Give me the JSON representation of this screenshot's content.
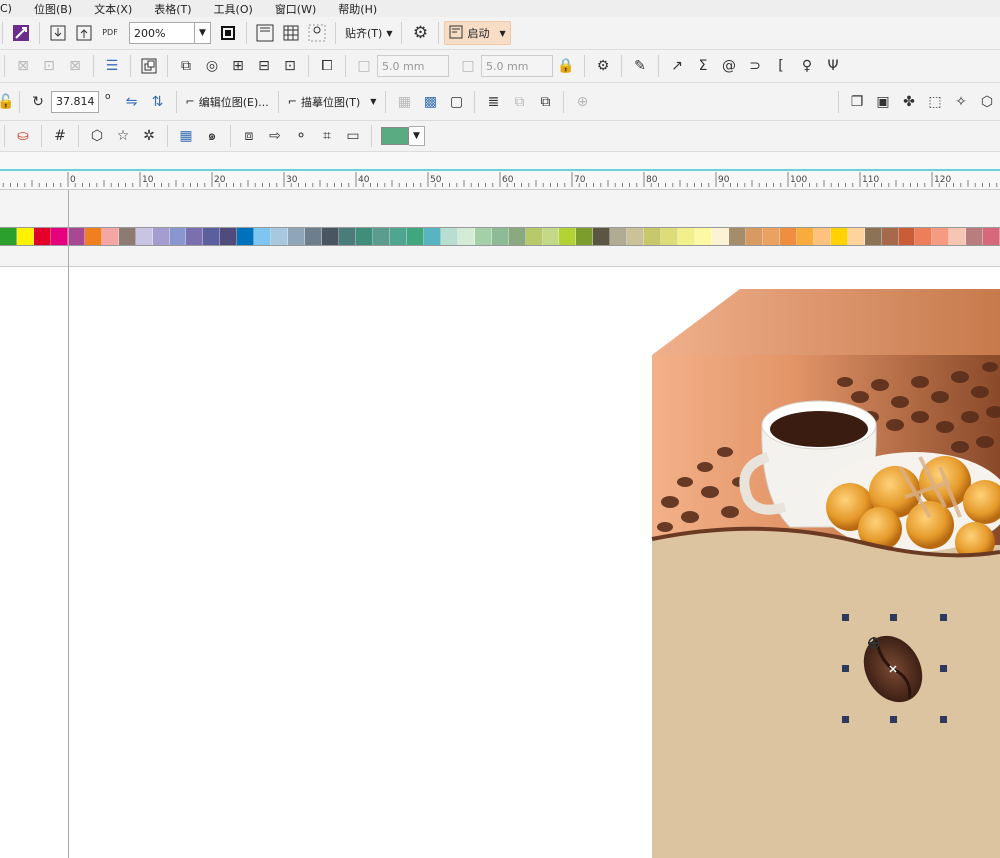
{
  "menu": [
    "C)",
    "位图(B)",
    "文本(X)",
    "表格(T)",
    "工具(O)",
    "窗口(W)",
    "帮助(H)"
  ],
  "toolbar1": {
    "pdf_label": "PDF",
    "zoom": "200%",
    "snap_label": "贴齐(T)",
    "launch_label": "启动"
  },
  "toolbar2": {
    "offset1": "5.0 mm",
    "offset2": "5.0 mm"
  },
  "toolbar3": {
    "angle": "37.814",
    "degree_symbol": "o",
    "edit_bitmap": "编辑位图(E)...",
    "trace_bitmap": "描摹位图(T)"
  },
  "toolbar4": {
    "fill_color": "#5aab82"
  },
  "ruler": {
    "ticks": [
      "0",
      "10",
      "20",
      "30",
      "40",
      "50",
      "60",
      "70",
      "80",
      "90",
      "100",
      "110",
      "120"
    ]
  },
  "palette": [
    "#2ca02c",
    "#fff200",
    "#e4002b",
    "#e6007e",
    "#a84893",
    "#f07f22",
    "#f4a6a4",
    "#8c7b70",
    "#c9c3e4",
    "#a49dd0",
    "#8a96cf",
    "#7b6faf",
    "#5a5f9e",
    "#4f4b7a",
    "#0072bc",
    "#7ec5ef",
    "#a8c8e0",
    "#8fa6b8",
    "#6d7f8c",
    "#49565f",
    "#4a7d7a",
    "#3e8e79",
    "#5a9c8d",
    "#50a58e",
    "#41a67d",
    "#58b4c0",
    "#b8ddd1",
    "#d4ebd6",
    "#a5cfa9",
    "#8dbb95",
    "#8aa97e",
    "#b7c96a",
    "#c4d987",
    "#b3d234",
    "#7c9d2c",
    "#5b5642",
    "#b2ab94",
    "#cbc29a",
    "#c7c76c",
    "#dcdc7a",
    "#f2ef8d",
    "#fcf8a3",
    "#fcf3d4",
    "#a58d6b",
    "#d99a61",
    "#e9a262",
    "#f08e3f",
    "#f8ac3c",
    "#fdc37e",
    "#ffd200",
    "#fed49c",
    "#8c7356",
    "#a6694b",
    "#ca5d38",
    "#ec7f5a",
    "#f59b82",
    "#f7c6b3",
    "#b87e7e",
    "#d5697b"
  ]
}
